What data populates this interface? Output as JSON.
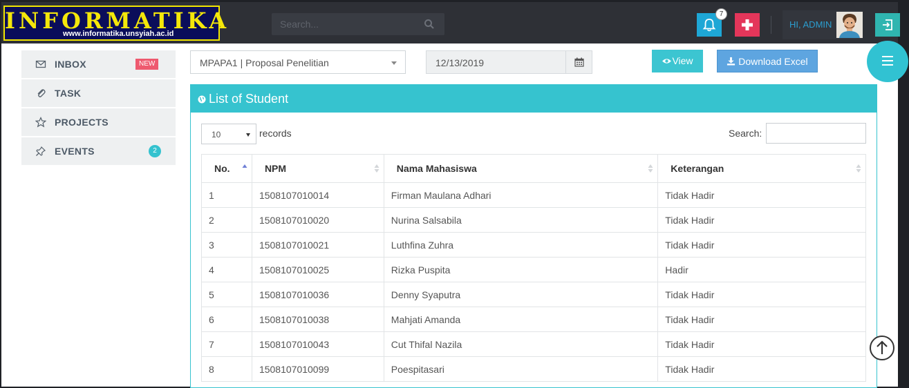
{
  "header": {
    "logo_title": "INFORMATIKA",
    "logo_subtitle": "www.informatika.unsyiah.ac.id",
    "search_placeholder": "Search...",
    "notification_count": "7",
    "user_greeting": "HI, ADMIN"
  },
  "sidebar": {
    "items": [
      {
        "label": "INBOX",
        "icon": "envelope-icon",
        "badge": "NEW"
      },
      {
        "label": "TASK",
        "icon": "paperclip-icon"
      },
      {
        "label": "PROJECTS",
        "icon": "star-icon"
      },
      {
        "label": "EVENTS",
        "icon": "pin-icon",
        "badge": "2"
      }
    ]
  },
  "toolbar": {
    "course_selected": "MPAPA1 | Proposal Penelitian",
    "date_value": "12/13/2019",
    "view_label": "View",
    "download_label": "Download Excel"
  },
  "panel": {
    "title": "List of Student",
    "page_length": "10",
    "records_label": "records",
    "search_label": "Search:"
  },
  "table": {
    "columns": [
      "No.",
      "NPM",
      "Nama Mahasiswa",
      "Keterangan"
    ],
    "rows": [
      [
        "1",
        "1508107010014",
        "Firman Maulana Adhari",
        "Tidak Hadir"
      ],
      [
        "2",
        "1508107010020",
        "Nurina Salsabila",
        "Tidak Hadir"
      ],
      [
        "3",
        "1508107010021",
        "Luthfina Zuhra",
        "Tidak Hadir"
      ],
      [
        "4",
        "1508107010025",
        "Rizka Puspita",
        "Hadir"
      ],
      [
        "5",
        "1508107010036",
        "Denny Syaputra",
        "Tidak Hadir"
      ],
      [
        "6",
        "1508107010038",
        "Mahjati Amanda",
        "Tidak Hadir"
      ],
      [
        "7",
        "1508107010043",
        "Cut Thifal Nazila",
        "Tidak Hadir"
      ],
      [
        "8",
        "1508107010099",
        "Poespitasari",
        "Tidak Hadir"
      ]
    ]
  },
  "colors": {
    "accent": "#36c3cf",
    "primary": "#5ea5e0",
    "danger": "#e4365a",
    "info": "#1ea7d6",
    "logo_bg": "#0a0d5a",
    "logo_text": "#f4e70a"
  }
}
